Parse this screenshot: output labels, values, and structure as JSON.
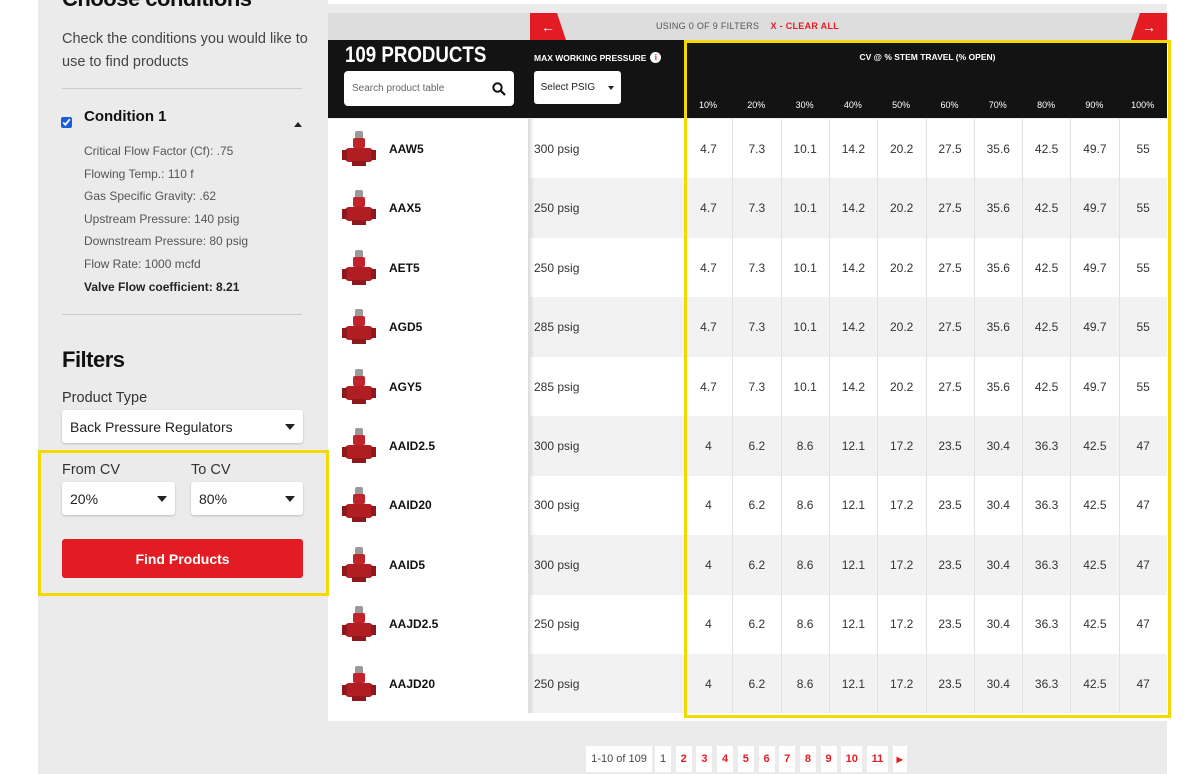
{
  "sidebar": {
    "heading": "Choose conditions",
    "intro": "Check the conditions you would like to use to find products",
    "condition": {
      "title": "Condition 1",
      "checked": true,
      "lines": [
        "Critical Flow Factor (Cf): .75",
        "Flowing Temp.: 110 f",
        "Gas Specific Gravity: .62",
        "Upstream Pressure: 140 psig",
        "Downstream Pressure: 80 psig",
        "Flow Rate: 1000 mcfd"
      ],
      "result": "Valve Flow coefficient: 8.21"
    },
    "filters_heading": "Filters",
    "product_type_label": "Product Type",
    "product_type_value": "Back Pressure Regulators",
    "from_cv_label": "From CV",
    "from_cv_value": "20%",
    "to_cv_label": "To CV",
    "to_cv_value": "80%",
    "find_button": "Find Products"
  },
  "filterbar": {
    "status": "USING 0 OF 9 FILTERS",
    "clear": "X - CLEAR ALL"
  },
  "table": {
    "count": "109 PRODUCTS",
    "search_placeholder": "Search product table",
    "pressure_header": "MAX WORKING PRESSURE",
    "psig_select": "Select PSIG",
    "cv_header": "CV @ % STEM TRAVEL (% OPEN)",
    "cv_columns": [
      "10%",
      "20%",
      "30%",
      "40%",
      "50%",
      "60%",
      "70%",
      "80%",
      "90%",
      "100%"
    ],
    "rows": [
      {
        "name": "AAW5",
        "pressure": "300 psig",
        "cv": [
          "4.7",
          "7.3",
          "10.1",
          "14.2",
          "20.2",
          "27.5",
          "35.6",
          "42.5",
          "49.7",
          "55"
        ]
      },
      {
        "name": "AAX5",
        "pressure": "250 psig",
        "cv": [
          "4.7",
          "7.3",
          "10.1",
          "14.2",
          "20.2",
          "27.5",
          "35.6",
          "42.5",
          "49.7",
          "55"
        ]
      },
      {
        "name": "AET5",
        "pressure": "250 psig",
        "cv": [
          "4.7",
          "7.3",
          "10.1",
          "14.2",
          "20.2",
          "27.5",
          "35.6",
          "42.5",
          "49.7",
          "55"
        ]
      },
      {
        "name": "AGD5",
        "pressure": "285 psig",
        "cv": [
          "4.7",
          "7.3",
          "10.1",
          "14.2",
          "20.2",
          "27.5",
          "35.6",
          "42.5",
          "49.7",
          "55"
        ]
      },
      {
        "name": "AGY5",
        "pressure": "285 psig",
        "cv": [
          "4.7",
          "7.3",
          "10.1",
          "14.2",
          "20.2",
          "27.5",
          "35.6",
          "42.5",
          "49.7",
          "55"
        ]
      },
      {
        "name": "AAID2.5",
        "pressure": "300 psig",
        "cv": [
          "4",
          "6.2",
          "8.6",
          "12.1",
          "17.2",
          "23.5",
          "30.4",
          "36.3",
          "42.5",
          "47"
        ]
      },
      {
        "name": "AAID20",
        "pressure": "300 psig",
        "cv": [
          "4",
          "6.2",
          "8.6",
          "12.1",
          "17.2",
          "23.5",
          "30.4",
          "36.3",
          "42.5",
          "47"
        ]
      },
      {
        "name": "AAID5",
        "pressure": "300 psig",
        "cv": [
          "4",
          "6.2",
          "8.6",
          "12.1",
          "17.2",
          "23.5",
          "30.4",
          "36.3",
          "42.5",
          "47"
        ]
      },
      {
        "name": "AAJD2.5",
        "pressure": "250 psig",
        "cv": [
          "4",
          "6.2",
          "8.6",
          "12.1",
          "17.2",
          "23.5",
          "30.4",
          "36.3",
          "42.5",
          "47"
        ]
      },
      {
        "name": "AAJD20",
        "pressure": "250 psig",
        "cv": [
          "4",
          "6.2",
          "8.6",
          "12.1",
          "17.2",
          "23.5",
          "30.4",
          "36.3",
          "42.5",
          "47"
        ]
      }
    ]
  },
  "pagination": {
    "range": "1-10 of 109",
    "pages": [
      "1",
      "2",
      "3",
      "4",
      "5",
      "6",
      "7",
      "8",
      "9",
      "10",
      "11"
    ],
    "current": "1"
  },
  "colors": {
    "accent": "#e31b23",
    "highlight": "#f5d800",
    "header": "#131313"
  }
}
